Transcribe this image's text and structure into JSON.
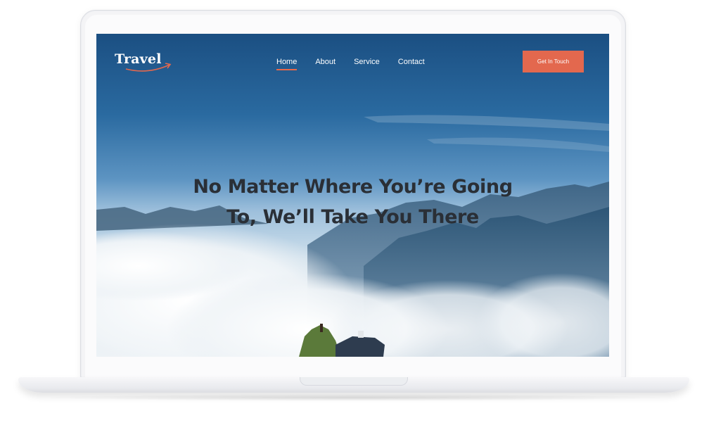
{
  "site": {
    "logo_text": "Travel"
  },
  "nav": {
    "items": [
      {
        "label": "Home",
        "active": true
      },
      {
        "label": "About",
        "active": false
      },
      {
        "label": "Service",
        "active": false
      },
      {
        "label": "Contact",
        "active": false
      }
    ],
    "cta_label": "Get In Touch"
  },
  "hero": {
    "headline_line1": "No Matter Where You’re Going",
    "headline_line2": "To, We’ll Take You There"
  },
  "colors": {
    "accent": "#e3684e",
    "sky_top": "#1f5b8e",
    "text_dark": "#2a2f36"
  },
  "icons": {
    "logo_swoosh": "arrow-swoosh-icon"
  }
}
